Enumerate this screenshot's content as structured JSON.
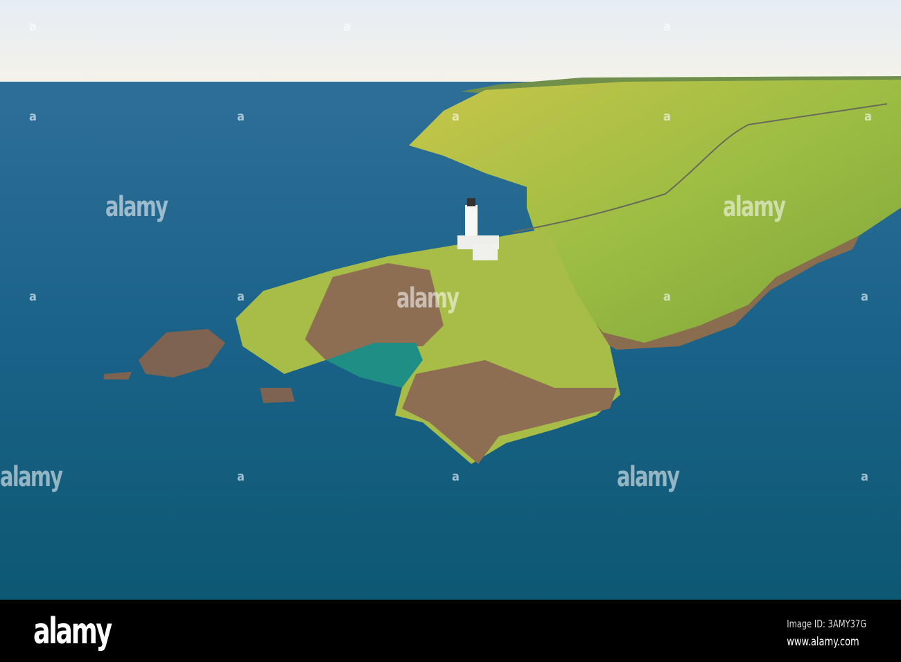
{
  "photo": {
    "colors": {
      "sky_top": "#e8eef5",
      "sky_horizon": "#f3f1ea",
      "sea_far": "#2f6e97",
      "sea_near": "#0f5a78",
      "grass": "#9cbd3f",
      "grass_light": "#c4c94a",
      "rock": "#8a6c4f",
      "cove": "#1f8f86"
    }
  },
  "watermark": {
    "text": "alamy",
    "small_mark": "a"
  },
  "footer": {
    "logo": "alamy",
    "image_id": "Image ID: 3AMY37G",
    "url": "www.alamy.com"
  }
}
